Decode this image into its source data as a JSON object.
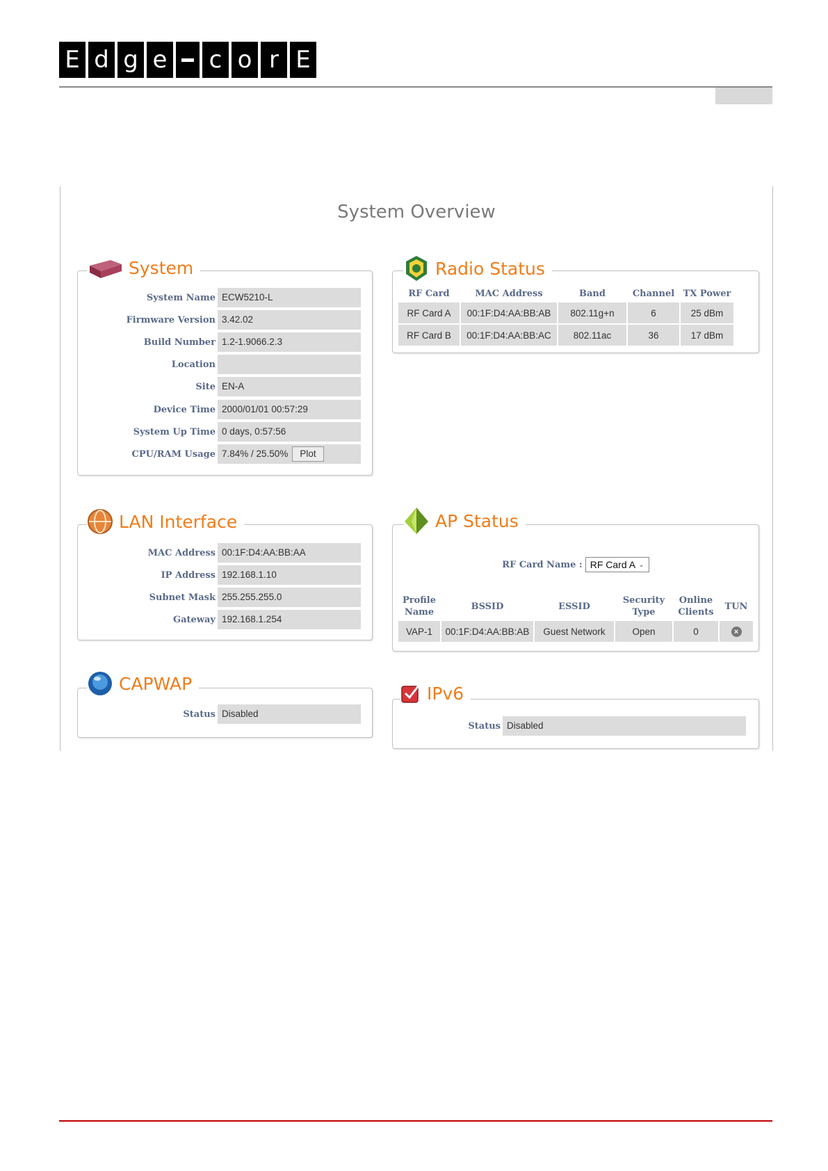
{
  "document": {
    "logo_letters": [
      "E",
      "d",
      "g",
      "e",
      "-",
      "c",
      "o",
      "r",
      "E"
    ]
  },
  "overview_title": "System Overview",
  "system": {
    "title": "System",
    "rows": [
      {
        "label": "System Name",
        "value": "ECW5210-L"
      },
      {
        "label": "Firmware Version",
        "value": "3.42.02"
      },
      {
        "label": "Build Number",
        "value": "1.2-1.9066.2.3"
      },
      {
        "label": "Location",
        "value": ""
      },
      {
        "label": "Site",
        "value": "EN-A"
      },
      {
        "label": "Device Time",
        "value": "2000/01/01 00:57:29"
      },
      {
        "label": "System Up Time",
        "value": "0 days, 0:57:56"
      },
      {
        "label": "CPU/RAM Usage",
        "value": "7.84% / 25.50%"
      }
    ],
    "plot_label": "Plot"
  },
  "radio_status": {
    "title": "Radio Status",
    "headers": [
      "RF Card",
      "MAC Address",
      "Band",
      "Channel",
      "TX Power"
    ],
    "rows": [
      [
        "RF Card A",
        "00:1F:D4:AA:BB:AB",
        "802.11g+n",
        "6",
        "25 dBm"
      ],
      [
        "RF Card B",
        "00:1F:D4:AA:BB:AC",
        "802.11ac",
        "36",
        "17 dBm"
      ]
    ]
  },
  "lan_interface": {
    "title": "LAN Interface",
    "rows": [
      {
        "label": "MAC Address",
        "value": "00:1F:D4:AA:BB:AA"
      },
      {
        "label": "IP Address",
        "value": "192.168.1.10"
      },
      {
        "label": "Subnet Mask",
        "value": "255.255.255.0"
      },
      {
        "label": "Gateway",
        "value": "192.168.1.254"
      }
    ]
  },
  "ap_status": {
    "title": "AP Status",
    "rf_card_label": "RF Card Name :",
    "rf_card_selected": "RF Card A",
    "headers": [
      [
        "Profile",
        "Name"
      ],
      [
        "BSSID"
      ],
      [
        "ESSID"
      ],
      [
        "Security",
        "Type"
      ],
      [
        "Online",
        "Clients"
      ],
      [
        "TUN"
      ]
    ],
    "rows": [
      [
        "VAP-1",
        "00:1F:D4:AA:BB:AB",
        "Guest Network",
        "Open",
        "0"
      ]
    ]
  },
  "capwap": {
    "title": "CAPWAP",
    "status_label": "Status",
    "status_value": "Disabled"
  },
  "ipv6": {
    "title": "IPv6",
    "status_label": "Status",
    "status_value": "Disabled"
  },
  "colors": {
    "accent": "#ee7d1b",
    "label": "#5a6a8a",
    "cell_bg": "#dcdcdc",
    "footer_rule": "#c00000"
  },
  "icons": {
    "system": "router-device-icon",
    "radio_status": "radio-badge-icon",
    "lan_interface": "network-globe-icon",
    "ap_status": "green-pyramid-icon",
    "capwap": "blue-orb-icon",
    "ipv6": "red-checkbox-icon",
    "tun": "close-circle-icon"
  }
}
